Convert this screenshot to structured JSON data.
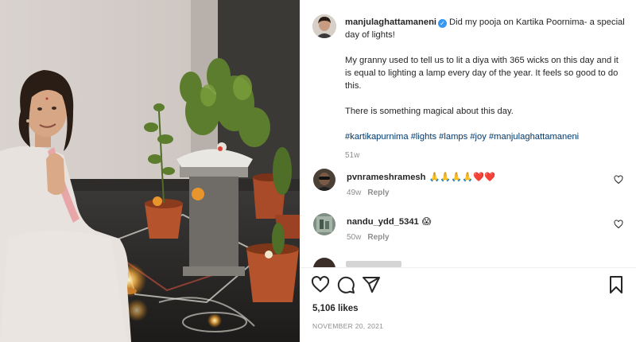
{
  "post": {
    "author": {
      "username": "manjulaghattamaneni",
      "verified": true,
      "avatar_icon": "profile-avatar"
    },
    "caption": {
      "line1": "Did my pooja on Kartika Poornima- a special day of lights!",
      "para2": "My granny used to tell us to lit a diya with 365 wicks on this day and it is equal to lighting a lamp every day of the year. It feels so good to do this.",
      "para3": "There is something magical about this day.",
      "hashtags": "#kartikapurnima #lights #lamps #joy #manjulaghattamaneni",
      "time_ago": "51w"
    },
    "comments": [
      {
        "username": "pvnrameshramesh",
        "text": "🙏🙏🙏🙏❤️❤️",
        "time": "49w",
        "reply_label": "Reply"
      },
      {
        "username": "nandu_ydd_5341",
        "text": "😱",
        "time": "50w",
        "reply_label": "Reply"
      }
    ],
    "likes": "5,106 likes",
    "date": "NOVEMBER 20, 2021",
    "colors": {
      "link": "#00376b",
      "verified": "#3897f0",
      "muted": "#8e8e8e"
    }
  }
}
